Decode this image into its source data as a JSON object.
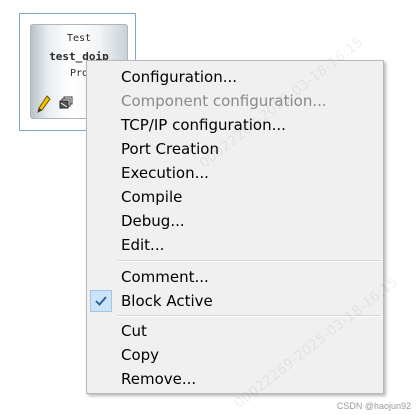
{
  "block": {
    "line1": "Test",
    "line2": "test_doip",
    "line3": "Pro",
    "icons": [
      "pencil-icon",
      "stack-icon"
    ]
  },
  "menu": {
    "items": [
      {
        "label": "Configuration...",
        "enabled": true
      },
      {
        "label": "Component configuration...",
        "enabled": false
      },
      {
        "label": "TCP/IP configuration...",
        "enabled": true
      },
      {
        "label": "Port Creation",
        "enabled": true
      },
      {
        "label": "Execution...",
        "enabled": true
      },
      {
        "label": "Compile",
        "enabled": true
      },
      {
        "label": "Debug...",
        "enabled": true
      },
      {
        "label": "Edit...",
        "enabled": true
      },
      {
        "label": "Comment...",
        "enabled": true
      },
      {
        "label": "Block Active",
        "enabled": true,
        "checked": true
      },
      {
        "label": "Cut",
        "enabled": true
      },
      {
        "label": "Copy",
        "enabled": true
      },
      {
        "label": "Remove...",
        "enabled": true
      }
    ]
  },
  "watermark_text": "00022269-2025-03-18-16:15",
  "credit": "CSDN @haojun92",
  "colors": {
    "menu_bg": "#f0f0f0",
    "disabled_text": "#8a8a8a",
    "check_highlight": "#cde3f7",
    "block_border": "#7ea6d9"
  }
}
